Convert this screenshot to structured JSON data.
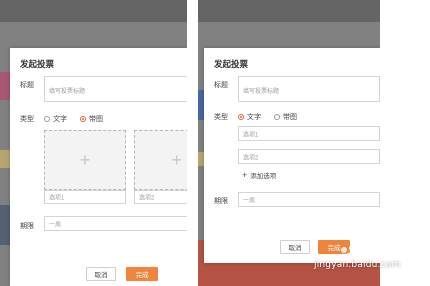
{
  "left": {
    "dialog_title": "发起投票",
    "title_label": "标题",
    "title_placeholder": "填写投票标题",
    "type_label": "类型",
    "type_options": [
      {
        "label": "文字",
        "selected": false
      },
      {
        "label": "带图",
        "selected": true
      }
    ],
    "image_options": [
      {
        "placeholder": "选项1"
      },
      {
        "placeholder": "选项2"
      }
    ],
    "deadline_label": "期限",
    "deadline_value": "一周",
    "cancel_label": "取消",
    "confirm_label": "完成"
  },
  "right": {
    "dialog_title": "发起投票",
    "title_label": "标题",
    "title_placeholder": "填写投票标题",
    "type_label": "类型",
    "type_options": [
      {
        "label": "文字",
        "selected": true
      },
      {
        "label": "带图",
        "selected": false
      }
    ],
    "text_options": [
      {
        "placeholder": "选项1"
      },
      {
        "placeholder": "选项2"
      }
    ],
    "add_option_label": "添加选项",
    "deadline_label": "期限",
    "deadline_value": "一周",
    "cancel_label": "取消",
    "confirm_label": "完成"
  },
  "watermark": {
    "text": "jingyan.baidu.com"
  },
  "colors": {
    "accent": "#f0843d",
    "radio_selected": "#e0633a"
  },
  "icons": [
    "plus-icon",
    "add-icon",
    "baidu-jingyan-logo"
  ]
}
